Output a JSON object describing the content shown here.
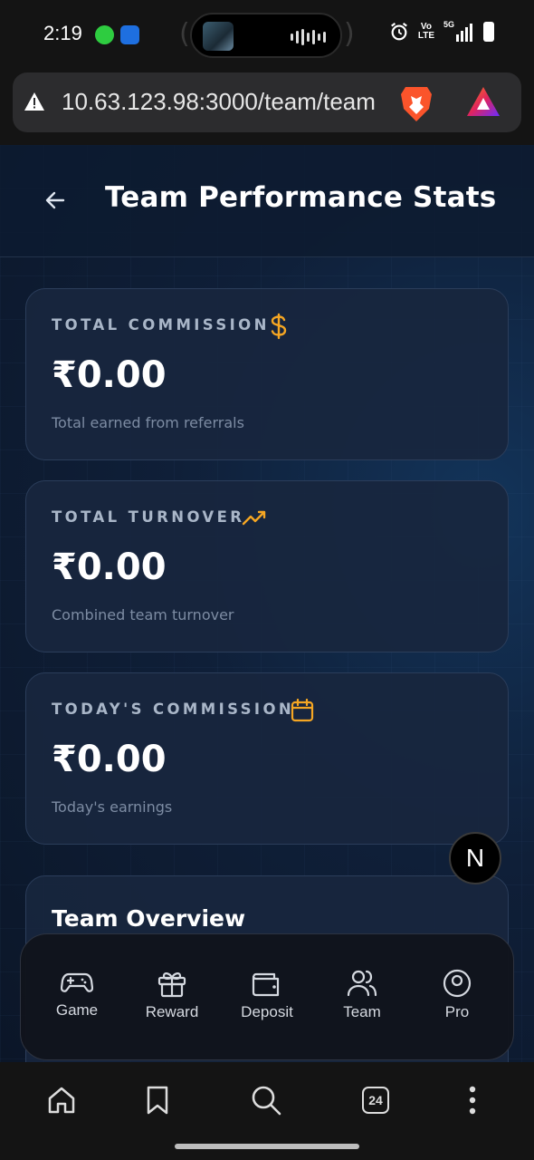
{
  "status_bar": {
    "time": "2:19",
    "network": "5G",
    "volte": "Vo\nLTE"
  },
  "browser": {
    "url": "10.63.123.98:3000/team/team",
    "tab_count": "24",
    "icons": [
      "warning-icon",
      "brave-lion-icon",
      "brave-rewards-icon"
    ]
  },
  "page": {
    "title": "Team Performance Stats",
    "cards": [
      {
        "label": "TOTAL COMMISSION",
        "value": "₹0.00",
        "sub": "Total earned from referrals",
        "icon": "dollar-icon"
      },
      {
        "label": "TOTAL TURNOVER",
        "value": "₹0.00",
        "sub": "Combined team turnover",
        "icon": "trending-up-icon"
      },
      {
        "label": "TODAY'S COMMISSION",
        "value": "₹0.00",
        "sub": "Today's earnings",
        "icon": "calendar-icon"
      }
    ],
    "overview_title": "Team Overview"
  },
  "nav": {
    "items": [
      {
        "label": "Game",
        "icon": "gamepad-icon"
      },
      {
        "label": "Reward",
        "icon": "gift-icon"
      },
      {
        "label": "Deposit",
        "icon": "wallet-icon"
      },
      {
        "label": "Team",
        "icon": "users-icon"
      },
      {
        "label": "Pro",
        "icon": "profile-icon"
      }
    ],
    "badge": "N"
  },
  "colors": {
    "accent": "#f5a623",
    "background": "#0b1628",
    "card": "#18263e"
  }
}
